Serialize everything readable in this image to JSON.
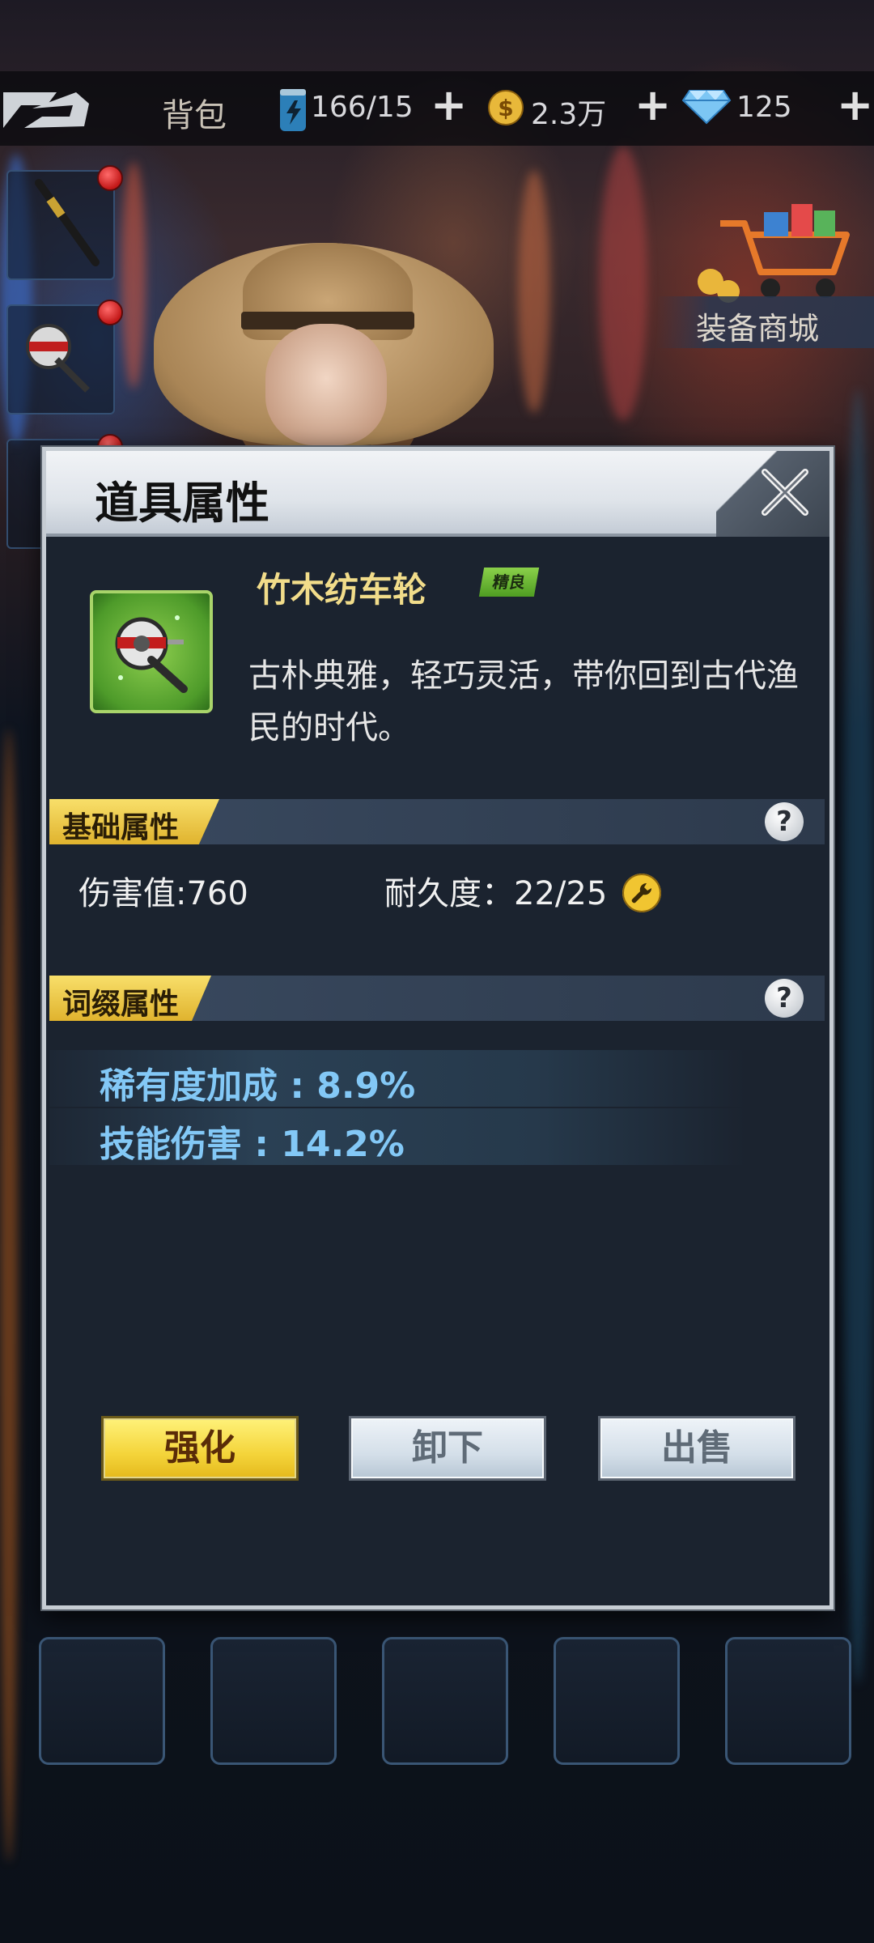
{
  "topbar": {
    "title": "背包",
    "energy": "166/15",
    "coins": "2.3万",
    "diamonds": "125",
    "plus": "+"
  },
  "shop": {
    "label": "装备商城"
  },
  "dialog": {
    "title": "道具属性",
    "item": {
      "name": "竹木纺车轮",
      "grade": "精良",
      "description": "古朴典雅，轻巧灵活，带你回到古代渔民的时代。"
    },
    "basic_section": {
      "label": "基础属性",
      "help": "?",
      "damage": "伤害值:760",
      "durability": "耐久度：22/25"
    },
    "affix_section": {
      "label": "词缀属性",
      "help": "?",
      "affixes": [
        "稀有度加成 : 8.9%",
        "技能伤害 : 14.2%"
      ]
    },
    "buttons": {
      "enhance": "强化",
      "unequip": "卸下",
      "sell": "出售"
    }
  },
  "colors": {
    "accent_gold": "#f4d43a",
    "item_name": "#f1dc8a",
    "affix_text": "#83c8f6",
    "grade_badge": "#6fbf33"
  },
  "icons": [
    "logo-icon",
    "energy-can-icon",
    "coin-icon",
    "diamond-icon",
    "shopping-cart-icon",
    "fishing-reel-icon",
    "fishing-rod-icon",
    "close-icon",
    "wrench-icon",
    "help-icon"
  ]
}
